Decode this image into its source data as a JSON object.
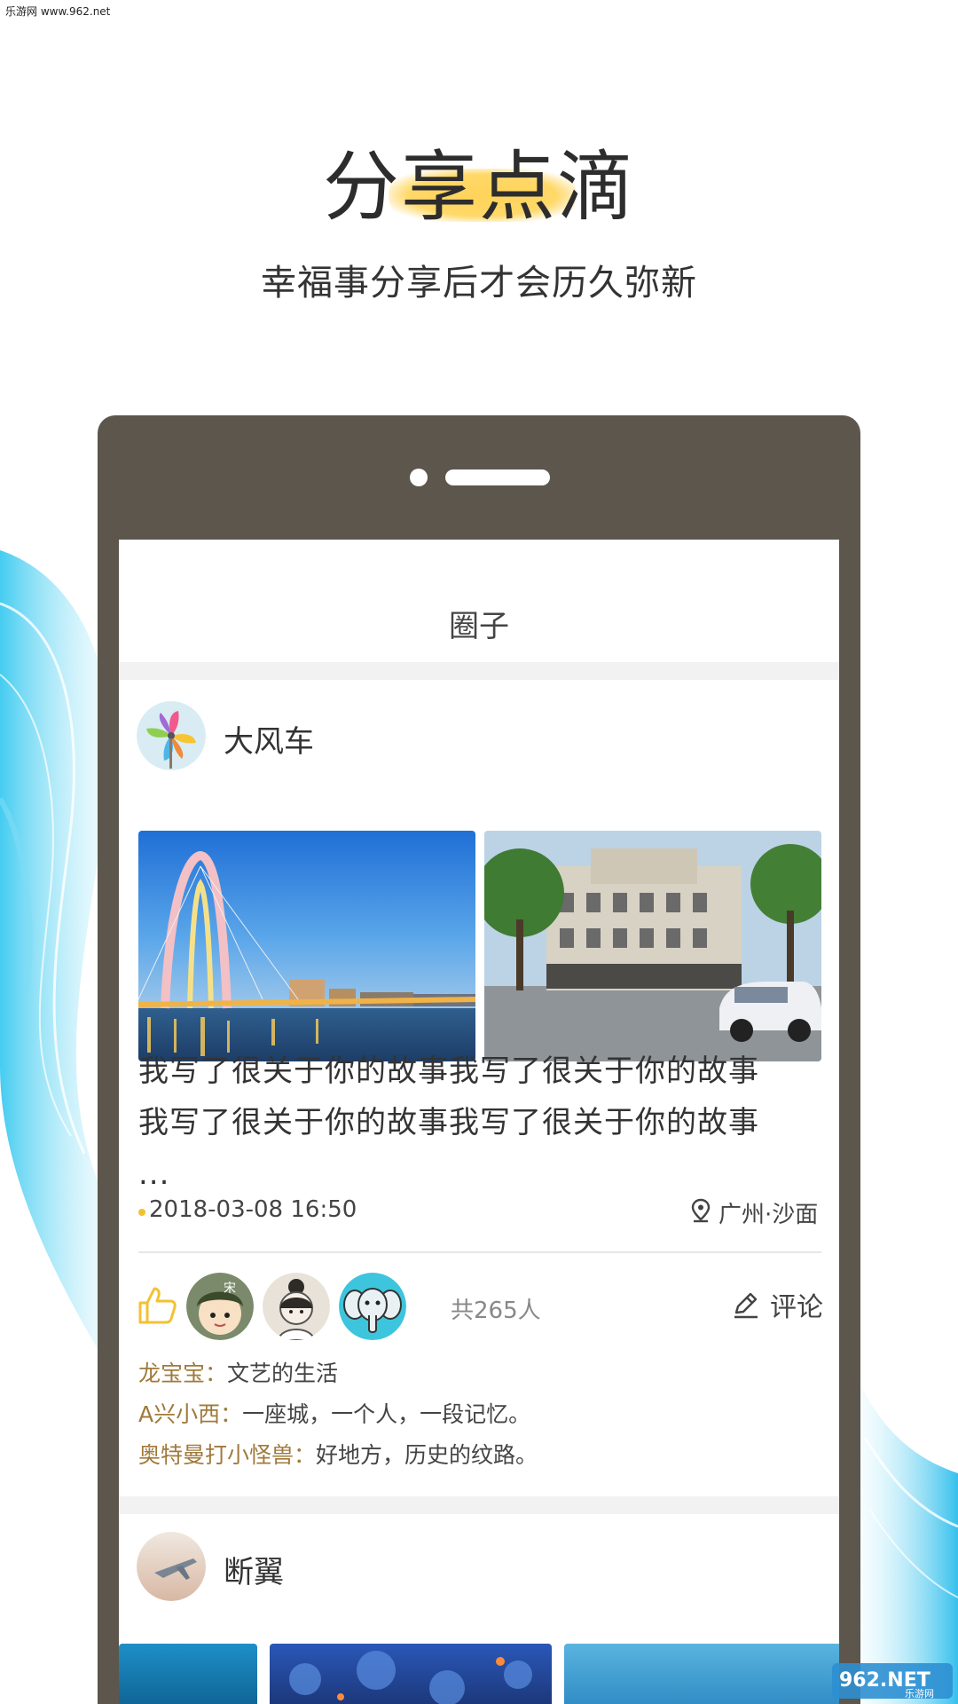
{
  "watermark": "乐游网 www.962.net",
  "hero": {
    "title": "分享点滴",
    "subtitle": "幸福事分享后才会历久弥新"
  },
  "app": {
    "nav_title": "圈子",
    "posts": [
      {
        "username": "大风车",
        "text_lines": [
          "我写了很关于你的故事我写了很关于你的故事",
          "我写了很关于你的故事我写了很关于你的故事",
          "..."
        ],
        "time": "2018-03-08 16:50",
        "location": "广州·沙面",
        "like_count_label": "共265人",
        "comment_label": "评论",
        "comments": [
          {
            "author": "龙宝宝：",
            "content": "文艺的生活"
          },
          {
            "author": "A兴小西：",
            "content": "一座城，一个人，一段记忆。"
          },
          {
            "author": "奥特曼打小怪兽：",
            "content": "好地方，历史的纹路。"
          }
        ]
      },
      {
        "username": "断翼"
      }
    ]
  },
  "colors": {
    "accent_yellow": "#ffd35a",
    "phone_frame": "#5d564d",
    "comment_author": "#a07a3c",
    "wave_blue": "#3ecbf0"
  },
  "icons": [
    "pinwheel-avatar",
    "bridge-photo",
    "street-photo",
    "location-pin-icon",
    "thumbs-up-icon",
    "pencil-icon",
    "elephant-avatar"
  ],
  "watermark_logo": {
    "main": "962.NET",
    "sub": "乐游网"
  }
}
